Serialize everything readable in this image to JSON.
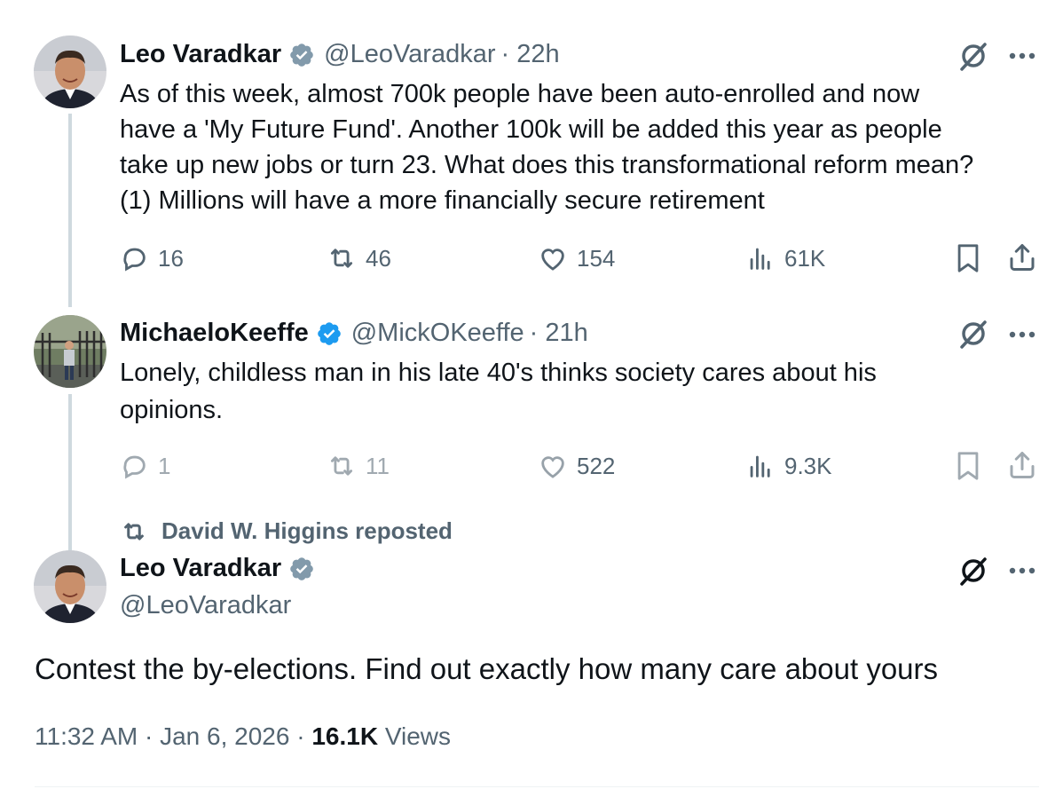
{
  "tweet1": {
    "name": "Leo Varadkar",
    "handle": "@LeoVaradkar",
    "time": "· 22h",
    "lines": [
      "As of this week, almost 700k people have been auto-enrolled and now",
      "have a 'My Future Fund'.  Another 100k will be added this year as people",
      "take up new jobs or turn 23.  What does this transformational reform mean?",
      "(1) Millions will have a more financially secure retirement"
    ],
    "replies": "16",
    "reposts": "46",
    "likes": "154",
    "views": "61K"
  },
  "tweet2": {
    "name": "MichaeloKeeffe",
    "handle": "@MickOKeeffe",
    "time": "· 21h",
    "lines": [
      "Lonely, childless man in his late 40's thinks society cares about his",
      "opinions."
    ],
    "replies": "1",
    "reposts": "11",
    "likes": "522",
    "views": "9.3K"
  },
  "repost_note": "David W. Higgins reposted",
  "tweet3": {
    "name": "Leo Varadkar",
    "handle": "@LeoVaradkar",
    "text": "Contest the by-elections.  Find out exactly how many care about yours",
    "timestamp": "11:32 AM · Jan 6, 2026 · ",
    "views_count": "16.1K",
    "views_label": " Views"
  },
  "colors": {
    "verified": "#829aab",
    "verified_blue": "#1d9bf0",
    "secondary": "#536471",
    "thread_line": "#cfd9de"
  },
  "icons": [
    "reply-icon",
    "repost-icon",
    "like-icon",
    "views-icon",
    "bookmark-icon",
    "share-icon",
    "grok-icon",
    "more-icon"
  ]
}
